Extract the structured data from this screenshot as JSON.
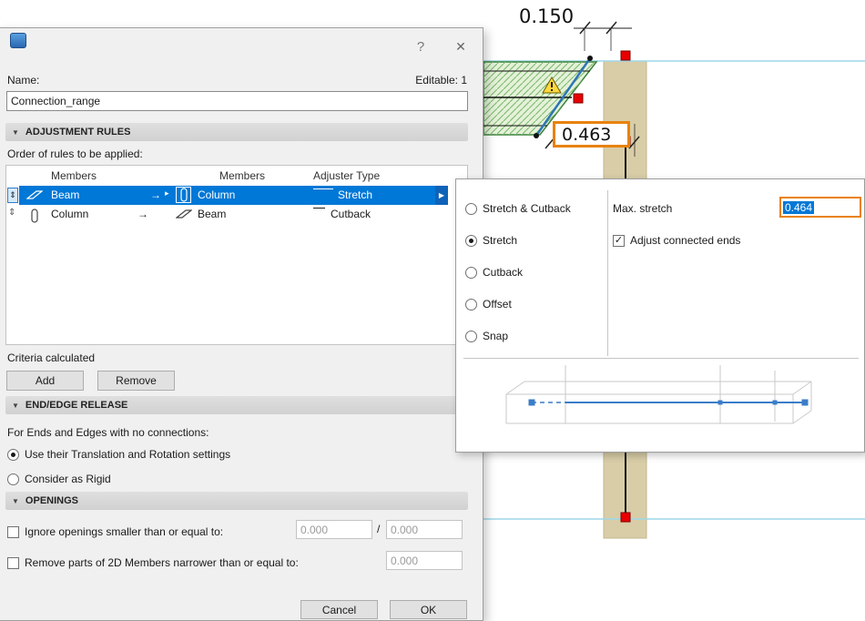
{
  "window": {
    "help": "?",
    "close": "✕"
  },
  "glyphs": {
    "chevron": "▼",
    "drag": "⇕",
    "arrow": "→",
    "small_arrow": "▸",
    "expander": "▶",
    "check": "✓"
  },
  "dialog": {
    "name_label": "Name:",
    "editable": "Editable: 1",
    "name_value": "Connection_range",
    "sections": {
      "adjustment": "ADJUSTMENT RULES",
      "end_edge": "END/EDGE RELEASE",
      "openings": "OPENINGS"
    },
    "order_label": "Order of rules to be applied:",
    "table": {
      "col_members1": "Members",
      "col_members2": "Members",
      "col_adjuster": "Adjuster Type",
      "rows": [
        {
          "member1": "Beam",
          "member2": "Column",
          "adjuster": "Stretch"
        },
        {
          "member1": "Column",
          "member2": "Beam",
          "adjuster": "Cutback"
        }
      ]
    },
    "criteria": "Criteria calculated",
    "add": "Add",
    "remove": "Remove",
    "end_edge_desc": "For Ends and Edges with no connections:",
    "radio_translation": "Use their Translation and Rotation settings",
    "radio_rigid": "Consider as Rigid",
    "ignore_label": "Ignore openings smaller than or equal to:",
    "ignore_v1": "0.000",
    "slash": "/",
    "ignore_v2": "0.000",
    "narrow_label": "Remove parts of 2D Members narrower than or equal to:",
    "narrow_v": "0.000",
    "cancel": "Cancel",
    "ok": "OK"
  },
  "popup": {
    "options": [
      {
        "label": "Stretch & Cutback"
      },
      {
        "label": "Stretch"
      },
      {
        "label": "Cutback"
      },
      {
        "label": "Offset"
      },
      {
        "label": "Snap"
      }
    ],
    "selected": "Stretch",
    "max_stretch_label": "Max. stretch",
    "max_stretch_value": "0.464",
    "adjust_ends_label": "Adjust connected ends"
  },
  "canvas": {
    "dim_top": "0.150",
    "dim_selected": "0.463"
  },
  "colors": {
    "selection_blue": "#0078d7",
    "highlight_orange": "#e8820c",
    "column_tan": "#d8cda7",
    "beam_green": "#e4f2d8",
    "axis_blue": "#2e75b6",
    "handle_red": "#e80000",
    "grid_cyan": "#9ed7e8"
  }
}
